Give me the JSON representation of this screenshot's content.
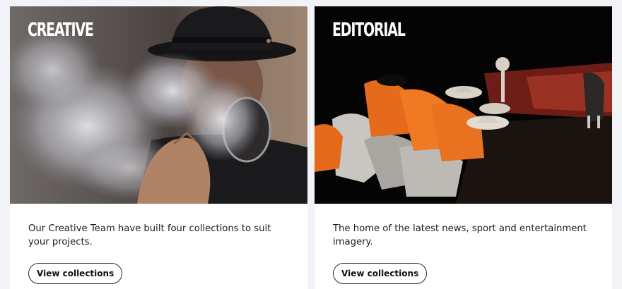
{
  "cards": [
    {
      "tag": "CREATIVE",
      "description": "Our Creative Team have built four collections to suit your projects.",
      "button_label": "View collections",
      "image_icon": "photo-smoke-portrait-icon"
    },
    {
      "tag": "EDITORIAL",
      "description": "The home of the latest news, sport and entertainment imagery.",
      "button_label": "View collections",
      "image_icon": "photo-horse-riders-icon"
    }
  ],
  "colors": {
    "page_background": "#f2f3f6",
    "card_background": "#ffffff",
    "text": "#1c1c1c",
    "button_border": "#2a2a2a"
  }
}
